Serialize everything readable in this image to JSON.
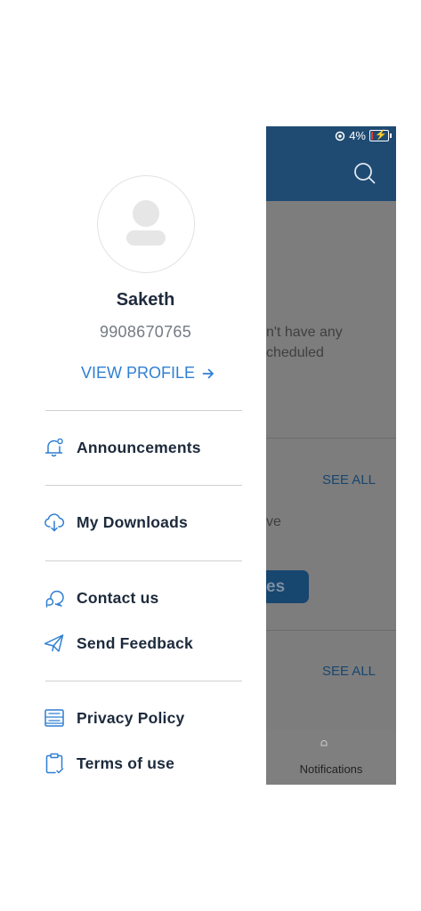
{
  "status_bar": {
    "battery": "4%"
  },
  "profile": {
    "name": "Saketh",
    "phone": "9908670765",
    "view_profile_label": "VIEW PROFILE"
  },
  "menu": {
    "announcements": "Announcements",
    "downloads": "My Downloads",
    "contact": "Contact us",
    "feedback": "Send Feedback",
    "privacy": "Privacy Policy",
    "terms": "Terms of use"
  },
  "background": {
    "empty_text": "n't have any\ncheduled",
    "see_all_1": "SEE ALL",
    "partial_text": "ve",
    "partial_button": "es",
    "see_all_2": "SEE ALL",
    "bottom_nav_notifications": "Notifications"
  },
  "colors": {
    "accent": "#2f7fd3",
    "header": "#1f4b73",
    "text": "#1d2a3c"
  }
}
